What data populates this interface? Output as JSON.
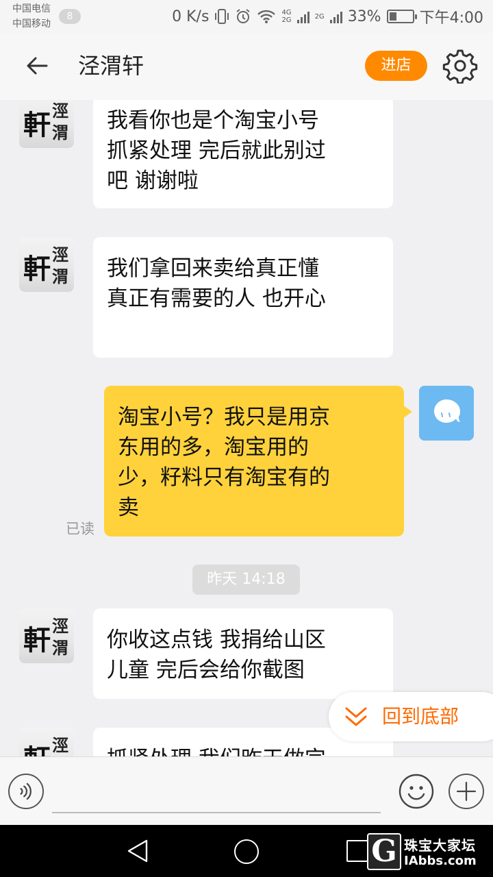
{
  "status_bar": {
    "carrier_1": "中国电信",
    "carrier_2": "中国移动",
    "notification_count": "8",
    "net_speed": "0 K/s",
    "net_4g_top": "4G",
    "net_4g_bottom": "2G",
    "net_2g": "2G",
    "battery_percent": "33%",
    "battery_level": 0.33,
    "time": "下午4:00"
  },
  "header": {
    "title": "泾渭轩",
    "enter_store_label": "进店"
  },
  "avatar_text": {
    "big": "軒",
    "small_top": "涇",
    "small_bottom": "渭"
  },
  "messages": [
    {
      "from": "shop",
      "text": "我看你也是个淘宝小号\n抓紧处理 完后就此别过\n吧 谢谢啦"
    },
    {
      "from": "shop",
      "text": "我们拿回来卖给真正懂\n真正有需要的人 也开心"
    },
    {
      "from": "me",
      "text": "淘宝小号？我只是用京\n东用的多，淘宝用的\n少，籽料只有淘宝有的\n卖",
      "status": "已读"
    },
    {
      "from": "time",
      "text": "昨天 14:18"
    },
    {
      "from": "shop",
      "text": "你收这点钱 我捐给山区\n儿童 完后会给你截图"
    },
    {
      "from": "shop",
      "text": "抓紧处理 我们昨天做完"
    }
  ],
  "scroll_to_bottom_label": "回到底部",
  "input": {
    "value": ""
  },
  "watermark": {
    "logo_letter": "G",
    "line1": "珠宝大家坛",
    "line2": "IAbbs.com"
  },
  "colors": {
    "accent": "#ff8a00",
    "my_bubble": "#ffd23c",
    "scroll_label": "#ff6a00"
  }
}
